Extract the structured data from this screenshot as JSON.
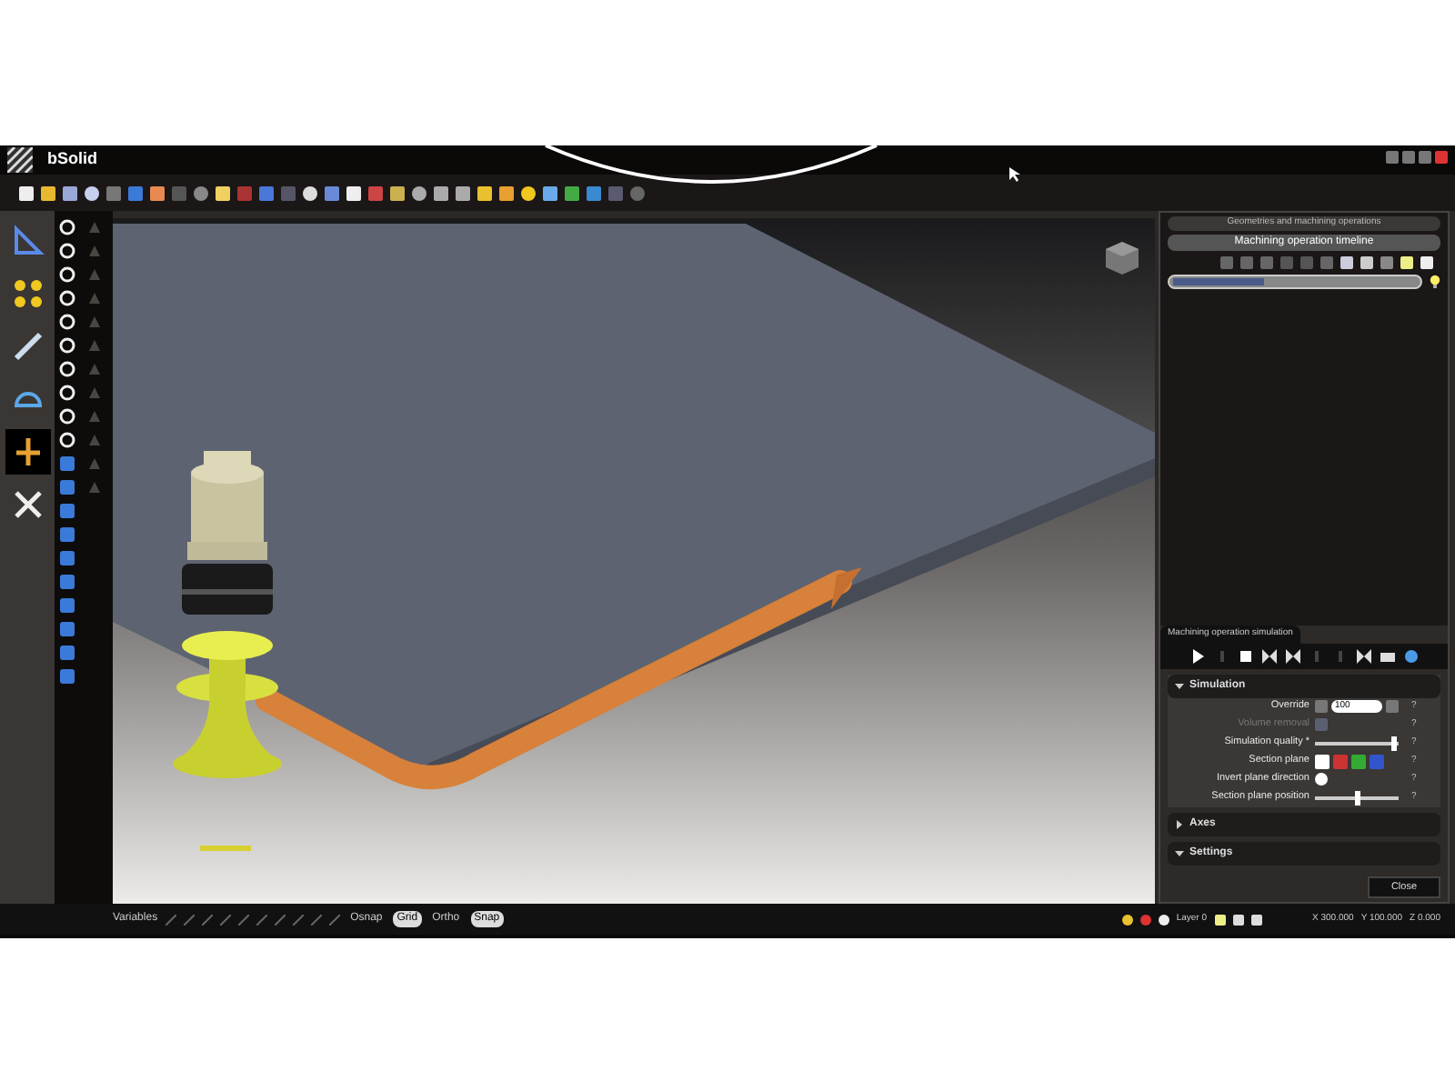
{
  "window": {
    "title": "bSolid"
  },
  "right_panel": {
    "geometries_header": "Geometries and machining operations",
    "timeline": {
      "title": "Machining operation timeline"
    },
    "simulation": {
      "title": "Machining operation simulation",
      "sections": [
        {
          "title": "Simulation",
          "expanded": true,
          "rows": [
            {
              "kind": "number",
              "label": "Override",
              "value": "100",
              "help": "?",
              "disabled": false
            },
            {
              "kind": "icon",
              "label": "Volume removal",
              "help": "?",
              "disabled": true
            },
            {
              "kind": "slider",
              "label": "Simulation quality *",
              "help": "?",
              "level": 0.95,
              "disabled": false
            },
            {
              "kind": "swatches",
              "label": "Section plane",
              "help": "?",
              "disabled": false
            },
            {
              "kind": "checkbox",
              "label": "Invert plane direction",
              "help": "?",
              "checked": false,
              "disabled": false
            },
            {
              "kind": "slider",
              "label": "Section plane position",
              "help": "?",
              "level": 0.5,
              "disabled": false
            }
          ]
        },
        {
          "title": "Axes",
          "expanded": false
        },
        {
          "title": "Settings",
          "expanded": true
        }
      ],
      "close_button": "Close"
    }
  },
  "status_bar": {
    "variables": "Variables",
    "toggles": [
      {
        "label": "Osnap",
        "on": false
      },
      {
        "label": "Grid",
        "on": true
      },
      {
        "label": "Ortho",
        "on": false
      },
      {
        "label": "Snap",
        "on": true
      }
    ],
    "layer": "Layer 0",
    "coordinates": [
      "X 300.000",
      "Y 100.000",
      "Z 0.000"
    ]
  }
}
